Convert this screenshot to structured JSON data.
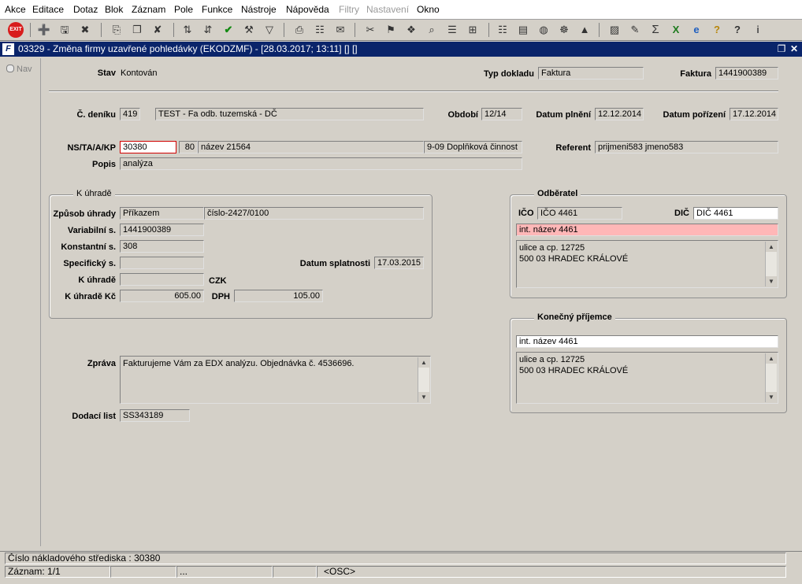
{
  "menu": [
    "Akce",
    "Editace",
    "Dotaz",
    "Blok",
    "Záznam",
    "Pole",
    "Funkce",
    "Nástroje",
    "Nápověda",
    "Filtry",
    "Nastavení",
    "Okno"
  ],
  "menu_disabled": [
    "Filtry",
    "Nastavení"
  ],
  "toolbar": {
    "exit_label": "EXIT",
    "icons": [
      "insert-record-icon",
      "save-record-icon",
      "delete-record-icon",
      "copy-icon",
      "duplicate-icon",
      "clear-icon",
      "sort-asc-icon",
      "sort-desc-icon",
      "check-icon",
      "wrench-icon",
      "filter-icon",
      "print-icon",
      "print-preview-icon",
      "mail-icon",
      "cut-icon",
      "paste-icon",
      "puzzle-icon",
      "zoom-icon",
      "list-icon",
      "tree-icon",
      "clipboard-icon",
      "document-icon",
      "globe-icon",
      "gear-icon",
      "map-icon",
      "chart-icon",
      "edit-icon",
      "sigma-icon",
      "excel-icon",
      "ie-icon",
      "help-icon",
      "question-icon",
      "info-icon"
    ]
  },
  "window": {
    "title": "03329 - Změna firmy uzavřené pohledávky (EKODZMF) - [28.03.2017; 13:11] [] []",
    "icon_letter": "F"
  },
  "nav": {
    "label": "Nav"
  },
  "form": {
    "stav_label": "Stav",
    "stav_value": "Kontován",
    "typ_dokladu_label": "Typ dokladu",
    "typ_dokladu_value": "Faktura",
    "faktura_label": "Faktura",
    "faktura_value": "1441900389",
    "denik_label": "Č. deníku",
    "denik_value": "419",
    "denik_nazev": "TEST - Fa odb. tuzemská - DČ",
    "obdobi_label": "Období",
    "obdobi_value": "12/14",
    "datum_plneni_label": "Datum plnění",
    "datum_plneni_value": "12.12.2014",
    "datum_porizeni_label": "Datum pořízení",
    "datum_porizeni_value": "17.12.2014",
    "ns_label": "NS/TA/A/KP",
    "ns_value": "30380",
    "ta_value": "80",
    "a_value": "název 21564",
    "kp_value": "9-09 Doplňková činnost",
    "referent_label": "Referent",
    "referent_value": "prijmeni583 jmeno583",
    "popis_label": "Popis",
    "popis_value": "analýza",
    "k_uhrade_group": "K úhradě",
    "zpusob_label": "Způsob úhrady",
    "zpusob_value": "Příkazem",
    "ucet_value": "číslo-2427/0100",
    "variabilni_label": "Variabilní s.",
    "variabilni_value": "1441900389",
    "konstantni_label": "Konstantní s.",
    "konstantni_value": "308",
    "specificky_label": "Specifický s.",
    "specificky_value": "",
    "splatnost_label": "Datum splatnosti",
    "splatnost_value": "17.03.2015",
    "k_uhrade_label": "K úhradě",
    "k_uhrade_value": "",
    "mena": "CZK",
    "k_uhrade_kc_label": "K úhradě Kč",
    "k_uhrade_kc_value": "605.00",
    "dph_label": "DPH",
    "dph_value": "105.00",
    "zprava_label": "Zpráva",
    "zprava_value": "Fakturujeme Vám za EDX analýzu. Objednávka č. 4536696.",
    "dodaci_label": "Dodací list",
    "dodaci_value": "SS343189",
    "odberatel_group": "Odběratel",
    "ico_label": "IČO",
    "ico_value": "IČO 4461",
    "dic_label": "DIČ",
    "dic_value": "DIČ 4461",
    "odberatel_nazev": "int. název 4461",
    "odberatel_adresa": [
      "ulice a cp. 12725",
      "500 03 HRADEC KRÁLOVÉ"
    ],
    "prijemce_group": "Konečný příjemce",
    "prijemce_nazev": "int. název 4461",
    "prijemce_adresa": [
      "ulice a cp. 12725",
      "500 03 HRADEC KRÁLOVÉ"
    ]
  },
  "status": {
    "hint": "Číslo nákladového střediska : 30380",
    "record": "Záznam: 1/1",
    "dots": "...",
    "mode": "<OSC>"
  }
}
